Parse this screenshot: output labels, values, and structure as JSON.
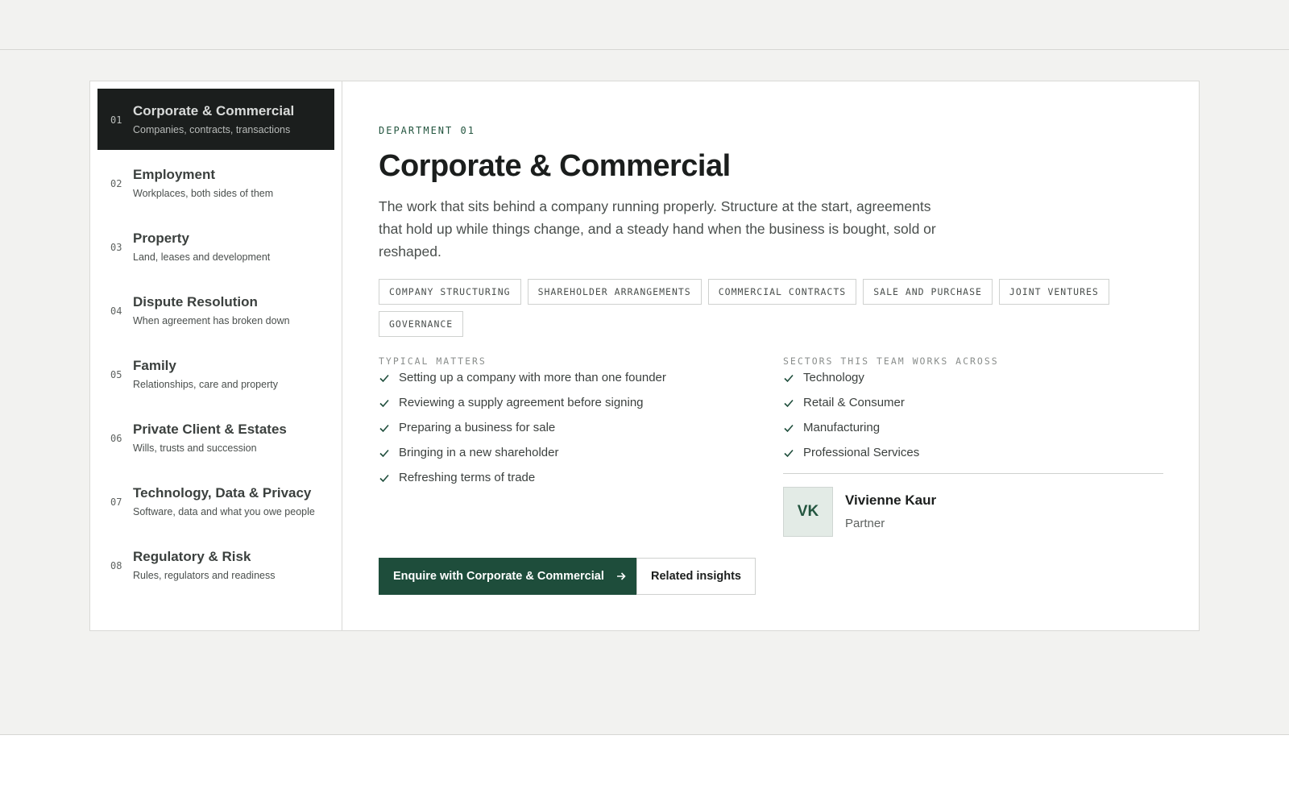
{
  "nav": {
    "items": [
      {
        "num": "01",
        "title": "Corporate & Commercial",
        "sub": "Companies, contracts, transactions"
      },
      {
        "num": "02",
        "title": "Employment",
        "sub": "Workplaces, both sides of them"
      },
      {
        "num": "03",
        "title": "Property",
        "sub": "Land, leases and development"
      },
      {
        "num": "04",
        "title": "Dispute Resolution",
        "sub": "When agreement has broken down"
      },
      {
        "num": "05",
        "title": "Family",
        "sub": "Relationships, care and property"
      },
      {
        "num": "06",
        "title": "Private Client & Estates",
        "sub": "Wills, trusts and succession"
      },
      {
        "num": "07",
        "title": "Technology, Data & Privacy",
        "sub": "Software, data and what you owe people"
      },
      {
        "num": "08",
        "title": "Regulatory & Risk",
        "sub": "Rules, regulators and readiness"
      }
    ]
  },
  "main": {
    "eyebrow": "DEPARTMENT 01",
    "title": "Corporate & Commercial",
    "lede": "The work that sits behind a company running properly. Structure at the start, agreements that hold up while things change, and a steady hand when the business is bought, sold or reshaped.",
    "tags": [
      "COMPANY STRUCTURING",
      "SHAREHOLDER ARRANGEMENTS",
      "COMMERCIAL CONTRACTS",
      "SALE AND PURCHASE",
      "JOINT VENTURES",
      "GOVERNANCE"
    ],
    "matters_label": "TYPICAL MATTERS",
    "matters": [
      "Setting up a company with more than one founder",
      "Reviewing a supply agreement before signing",
      "Preparing a business for sale",
      "Bringing in a new shareholder",
      "Refreshing terms of trade"
    ],
    "sectors_label": "SECTORS THIS TEAM WORKS ACROSS",
    "sectors": [
      "Technology",
      "Retail & Consumer",
      "Manufacturing",
      "Professional Services"
    ],
    "contact": {
      "initials": "VK",
      "name": "Vivienne Kaur",
      "role": "Partner"
    },
    "primary_button": "Enquire with Corporate & Commercial",
    "secondary_button": "Related insights"
  },
  "colors": {
    "accent": "#1e4d3b",
    "active_nav_bg": "#1b1e1d",
    "page_bg": "#f2f2f0"
  },
  "icons": {
    "check": "check-icon",
    "arrow": "arrow-right-icon"
  },
  "active_nav_index": 0
}
